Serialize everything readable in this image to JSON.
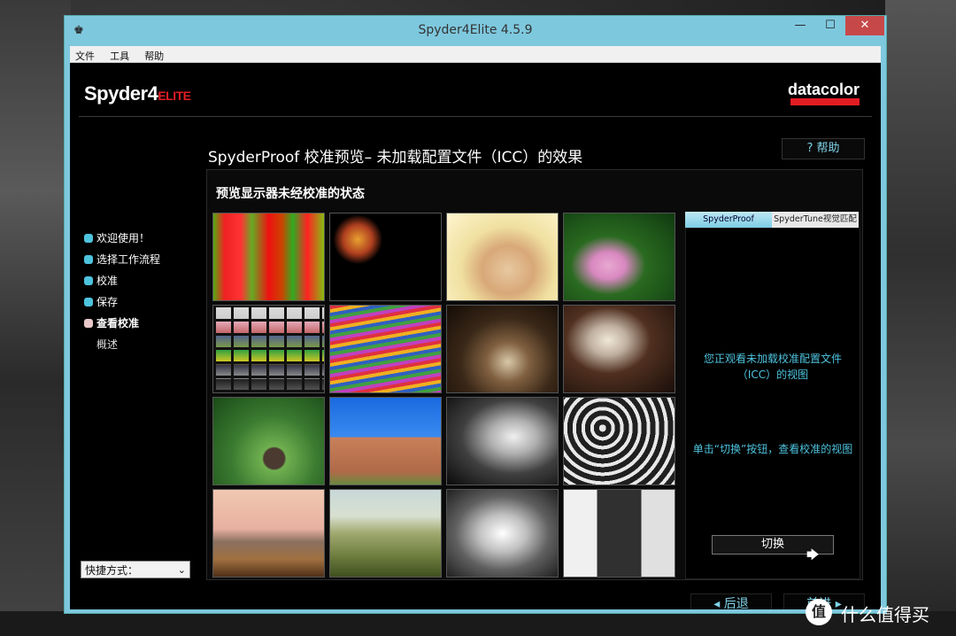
{
  "window": {
    "title": "Spyder4Elite 4.5.9",
    "controls": {
      "minimize": "—",
      "maximize": "☐",
      "close": "✕"
    },
    "app_icon": "spyder-icon"
  },
  "menu": [
    "文件",
    "工具",
    "帮助"
  ],
  "brand": {
    "spyder_main": "Spyder4",
    "spyder_suffix": "ELITE",
    "datacolor": "datacolor"
  },
  "page": {
    "title": "SpyderProof 校准预览– 未加载配置文件（ICC）的效果",
    "help": "? 帮助",
    "subtitle": "预览显示器未经校准的状态"
  },
  "nav": {
    "items": [
      {
        "label": "欢迎使用！"
      },
      {
        "label": "选择工作流程"
      },
      {
        "label": "校准"
      },
      {
        "label": "保存"
      },
      {
        "label": "查看校准"
      }
    ],
    "sub": "概述"
  },
  "tabs": {
    "active": "SpyderProof",
    "inactive": "SpyderTune视觉匹配"
  },
  "info": {
    "line1": "您正观看未加载校准配置文件（ICC）的视图",
    "line2": "单击“切换”按钮，查看校准的视图"
  },
  "switch_label": "切换",
  "shortcut": {
    "label": "快捷方式：",
    "arrow": "⌄"
  },
  "footer": {
    "back": "◂  后退",
    "next": "前进  ▸"
  },
  "watermark": {
    "icon": "值",
    "text": "什么值得买"
  }
}
